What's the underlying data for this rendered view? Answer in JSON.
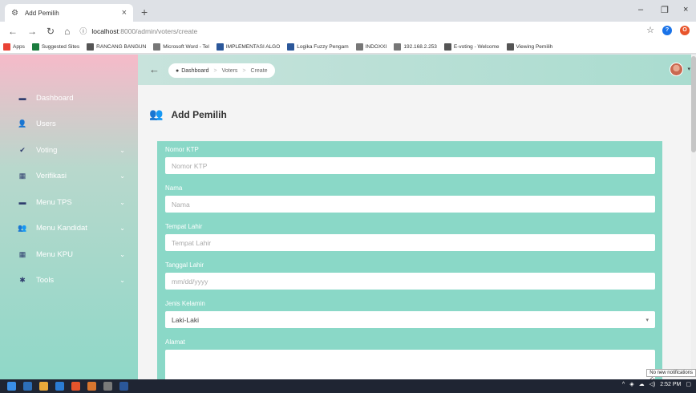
{
  "browser": {
    "tab_title": "Add Pemilih",
    "tab_close": "×",
    "new_tab": "+",
    "url_host": "localhost",
    "url_path": ":8000/admin/voters/create",
    "win_min": "–",
    "win_restore": "❐",
    "win_close": "×"
  },
  "bookmarks": [
    {
      "label": "Apps",
      "color": "#e94235"
    },
    {
      "label": "Suggested Sites",
      "color": "#1b7c3e"
    },
    {
      "label": "RANCANG BANGUN",
      "color": "#555555"
    },
    {
      "label": "Microsoft Word - Tel",
      "color": "#777777"
    },
    {
      "label": "IMPLEMENTASI ALGO",
      "color": "#2b579a"
    },
    {
      "label": "Logika Fuzzy Pengam",
      "color": "#2b579a"
    },
    {
      "label": "INDOXXI",
      "color": "#777777"
    },
    {
      "label": "192.168.2.253",
      "color": "#777777"
    },
    {
      "label": "E-voting - Welcome",
      "color": "#555555"
    },
    {
      "label": "Viewing Pemilih",
      "color": "#555555"
    }
  ],
  "breadcrumb": {
    "home": "Dashboard",
    "sep1": ">",
    "voters": "Voters",
    "sep2": ">",
    "current": "Create"
  },
  "sidebar": {
    "items": [
      {
        "label": "Dashboard",
        "icon": "▬",
        "chevron": ""
      },
      {
        "label": "Users",
        "icon": "👤",
        "chevron": ""
      },
      {
        "label": "Voting",
        "icon": "✔",
        "chevron": "⌄"
      },
      {
        "label": "Verifikasi",
        "icon": "▦",
        "chevron": "⌄"
      },
      {
        "label": "Menu TPS",
        "icon": "▬",
        "chevron": "⌄"
      },
      {
        "label": "Menu Kandidat",
        "icon": "👥",
        "chevron": "⌄"
      },
      {
        "label": "Menu KPU",
        "icon": "▦",
        "chevron": "⌄"
      },
      {
        "label": "Tools",
        "icon": "✱",
        "chevron": "⌄"
      }
    ]
  },
  "page": {
    "title": "Add Pemilih"
  },
  "form": {
    "nomor_ktp_label": "Nomor KTP",
    "nomor_ktp_placeholder": "Nomor KTP",
    "nama_label": "Nama",
    "nama_placeholder": "Nama",
    "tempat_lahir_label": "Tempat Lahir",
    "tempat_lahir_placeholder": "Tempat Lahir",
    "tanggal_lahir_label": "Tanggal Lahir",
    "tanggal_lahir_placeholder": "mm/dd/yyyy",
    "jenis_kelamin_label": "Jenis Kelamin",
    "jenis_kelamin_value": "Laki-Laki",
    "alamat_label": "Alamat"
  },
  "taskbar": {
    "time": "2:52 PM",
    "notification": "No new notifications"
  },
  "colors": {
    "sidebar_top": "#f6bac9",
    "sidebar_bottom": "#8fd8c8",
    "form_panel": "#8ad8c7",
    "icon_dark": "#2f3d6e"
  }
}
